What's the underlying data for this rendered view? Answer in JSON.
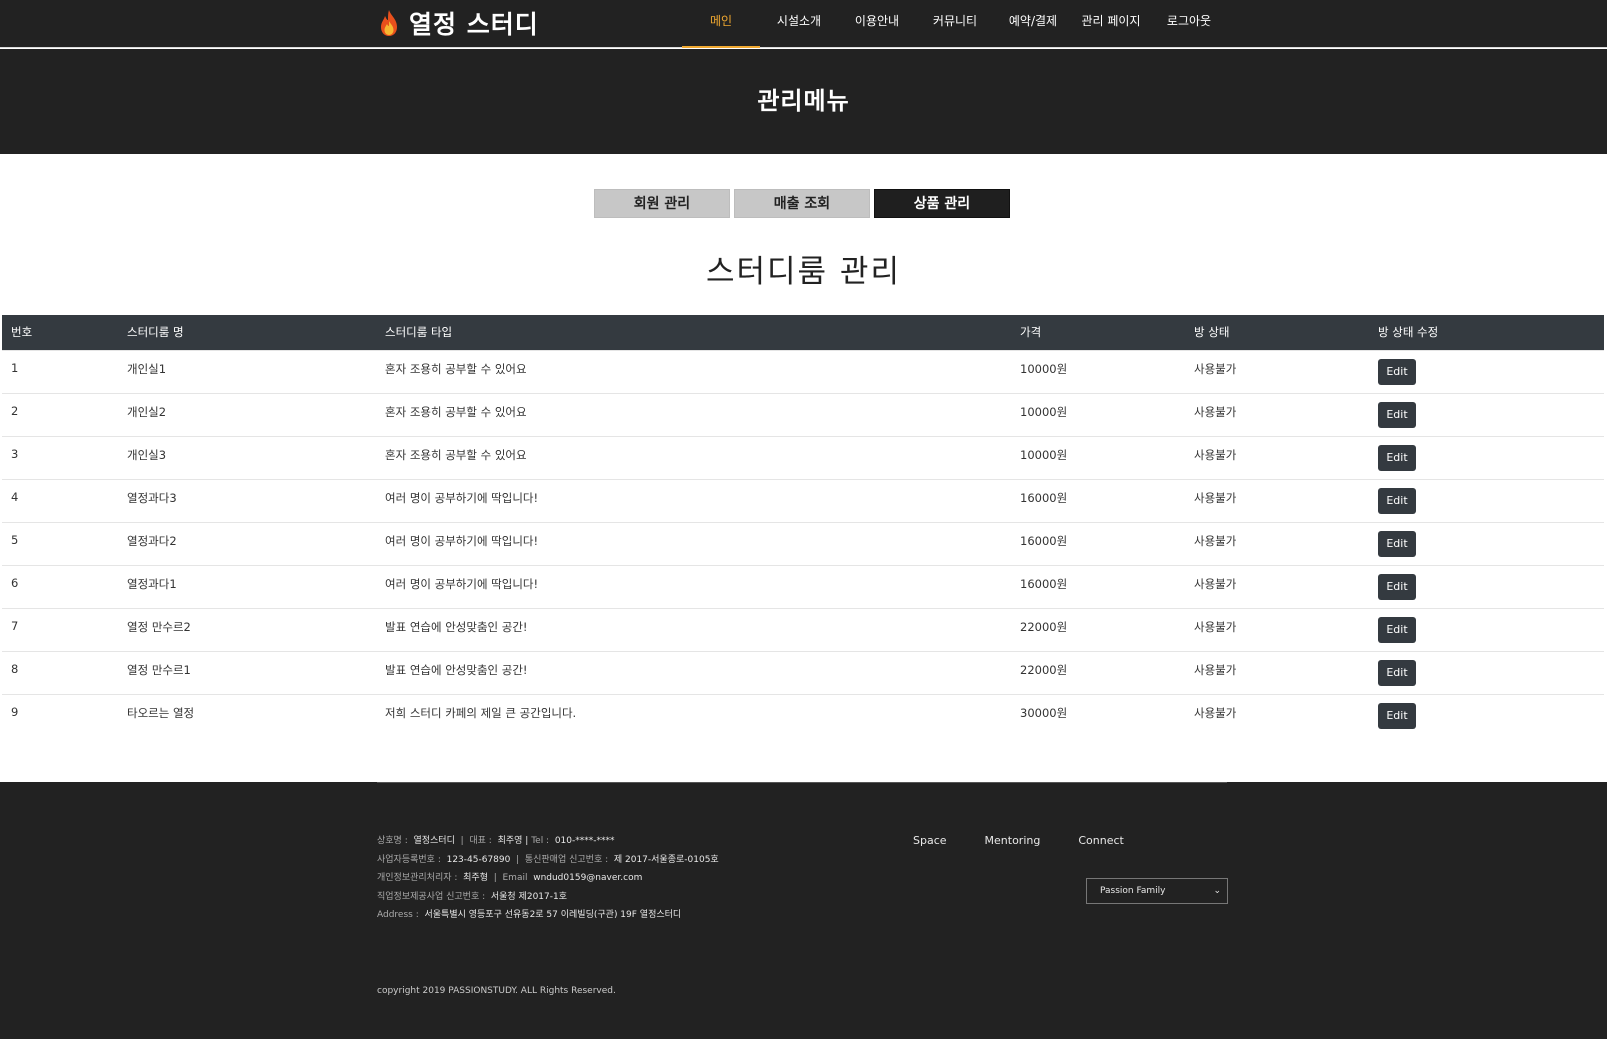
{
  "header": {
    "logo_text": "열정 스터디",
    "nav": [
      {
        "label": "메인",
        "active": true
      },
      {
        "label": "시설소개"
      },
      {
        "label": "이용안내"
      },
      {
        "label": "커뮤니티"
      },
      {
        "label": "예약/결제"
      },
      {
        "label": "관리 페이지"
      },
      {
        "label": "로그아웃"
      }
    ]
  },
  "hero": {
    "title": "관리메뉴"
  },
  "tabs": [
    {
      "label": "회원 관리"
    },
    {
      "label": "매출 조회"
    },
    {
      "label": "상품 관리",
      "active": true
    }
  ],
  "section_title": "스터디룸 관리",
  "table": {
    "headers": [
      "번호",
      "스터디룸 명",
      "스터디룸 타입",
      "가격",
      "방 상태",
      "방 상태 수정"
    ],
    "rows": [
      {
        "no": "1",
        "name": "개인실1",
        "type": "혼자 조용히 공부할 수 있어요",
        "price": "10000원",
        "status": "사용불가",
        "action": "Edit"
      },
      {
        "no": "2",
        "name": "개인실2",
        "type": "혼자 조용히 공부할 수 있어요",
        "price": "10000원",
        "status": "사용불가",
        "action": "Edit"
      },
      {
        "no": "3",
        "name": "개인실3",
        "type": "혼자 조용히 공부할 수 있어요",
        "price": "10000원",
        "status": "사용불가",
        "action": "Edit"
      },
      {
        "no": "4",
        "name": "열정과다3",
        "type": "여러 명이 공부하기에 딱입니다!",
        "price": "16000원",
        "status": "사용불가",
        "action": "Edit"
      },
      {
        "no": "5",
        "name": "열정과다2",
        "type": "여러 명이 공부하기에 딱입니다!",
        "price": "16000원",
        "status": "사용불가",
        "action": "Edit"
      },
      {
        "no": "6",
        "name": "열정과다1",
        "type": "여러 명이 공부하기에 딱입니다!",
        "price": "16000원",
        "status": "사용불가",
        "action": "Edit"
      },
      {
        "no": "7",
        "name": "열정 만수르2",
        "type": "발표 연습에 안성맞춤인 공간!",
        "price": "22000원",
        "status": "사용불가",
        "action": "Edit"
      },
      {
        "no": "8",
        "name": "열정 만수르1",
        "type": "발표 연습에 안성맞춤인 공간!",
        "price": "22000원",
        "status": "사용불가",
        "action": "Edit"
      },
      {
        "no": "9",
        "name": "타오르는 열정",
        "type": "저희 스터디 카페의 제일 큰 공간입니다.",
        "price": "30000원",
        "status": "사용불가",
        "action": "Edit"
      }
    ]
  },
  "footer": {
    "info": {
      "company_label": "상호명 :",
      "company": "열정스터디",
      "ceo_label": "대표 :",
      "ceo": "최주영",
      "tel_label": "Tel :",
      "tel": "010-****-****",
      "biz_label": "사업자등록번호 :",
      "biz": "123-45-67890",
      "mail_order_label": "통신판매업 신고번호 :",
      "mail_order": "제 2017-서울종로-0105호",
      "privacy_label": "개인정보관리처리자 :",
      "privacy": "최주형",
      "email_label": "Email",
      "email": "wndud0159@naver.com",
      "job_label": "직업정보제공사업 신고번호 :",
      "job": "서울청 제2017-1호",
      "address_label": "Address :",
      "address": "서울특별시 영등포구 선유동2로 57 이레빌딩(구관) 19F 열정스터디"
    },
    "links": [
      "Space",
      "Mentoring",
      "Connect"
    ],
    "family_select": "Passion Family",
    "copyright": "copyright 2019 PASSIONSTUDY. ALL Rights Reserved."
  },
  "colors": {
    "header_bg": "#222222",
    "accent": "#f0a830",
    "table_header_bg": "#343a40",
    "button_bg": "#343a40"
  }
}
